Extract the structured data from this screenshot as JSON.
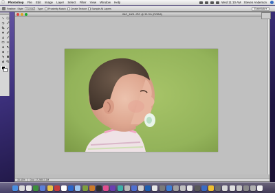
{
  "menubar": {
    "app": "Photoshop",
    "items": [
      "File",
      "Edit",
      "Image",
      "Layer",
      "Select",
      "Filter",
      "View",
      "Window",
      "Help"
    ],
    "clock": "Wed 11:10 AM",
    "user": "Steven Anderson"
  },
  "options": {
    "feather_label": "Feather:",
    "style_label": "Style:",
    "style_value": "Normal",
    "type_label": "Type:",
    "proximity_label": "Proximity Match",
    "create_texture_label": "Create Texture",
    "sample_all_label": "Sample All Layers",
    "workspace_label": "Essentials ▾"
  },
  "document": {
    "title": "IMG_1601.JPG @ 33.3% (RGB/8)",
    "zoom": "33.33%",
    "doc_size": "Doc: 17.2M/17.2M"
  },
  "tools": {
    "icons": [
      "move-icon",
      "marquee-icon",
      "lasso-icon",
      "magic-wand-icon",
      "crop-icon",
      "eyedropper-icon",
      "healing-brush-icon",
      "brush-icon",
      "clone-stamp-icon",
      "history-brush-icon",
      "eraser-icon",
      "gradient-icon",
      "blur-icon",
      "dodge-icon",
      "pen-icon",
      "type-icon",
      "path-select-icon",
      "shape-icon",
      "hand-icon",
      "zoom-icon"
    ],
    "foreground": "#000000",
    "background": "#ffffff"
  },
  "dock": {
    "colors": [
      "#4a8fe0",
      "#d9d9d9",
      "#e8e8e8",
      "#3d8f3d",
      "#5c7fd8",
      "#e8c24a",
      "#c43c3c",
      "#ffffff",
      "#2b66c9",
      "#9ec7f2",
      "#7f9f3f",
      "#cc7a2a",
      "#2f2f2f",
      "#e04f8f",
      "#6a3fb0",
      "#3fb0a8",
      "#b8b8b8",
      "#4f6fd0",
      "#d0d0d0",
      "#1f5fb0",
      "#e8e8e8",
      "#7a7a7a",
      "#3e7ed6",
      "#a0a0a0",
      "#c0c0c0",
      "#e8e8e8",
      "#5a5a5a",
      "#3b6bc2",
      "#f0c030",
      "#6f6f6f",
      "#d8d8d8",
      "#e0e0e0",
      "#c8c8c8",
      "#8a8a8a",
      "#b0b0b0",
      "#f2f2f2"
    ]
  },
  "colors": {
    "photo_background": "#94b65a",
    "canvas": "#c0c0c0"
  }
}
